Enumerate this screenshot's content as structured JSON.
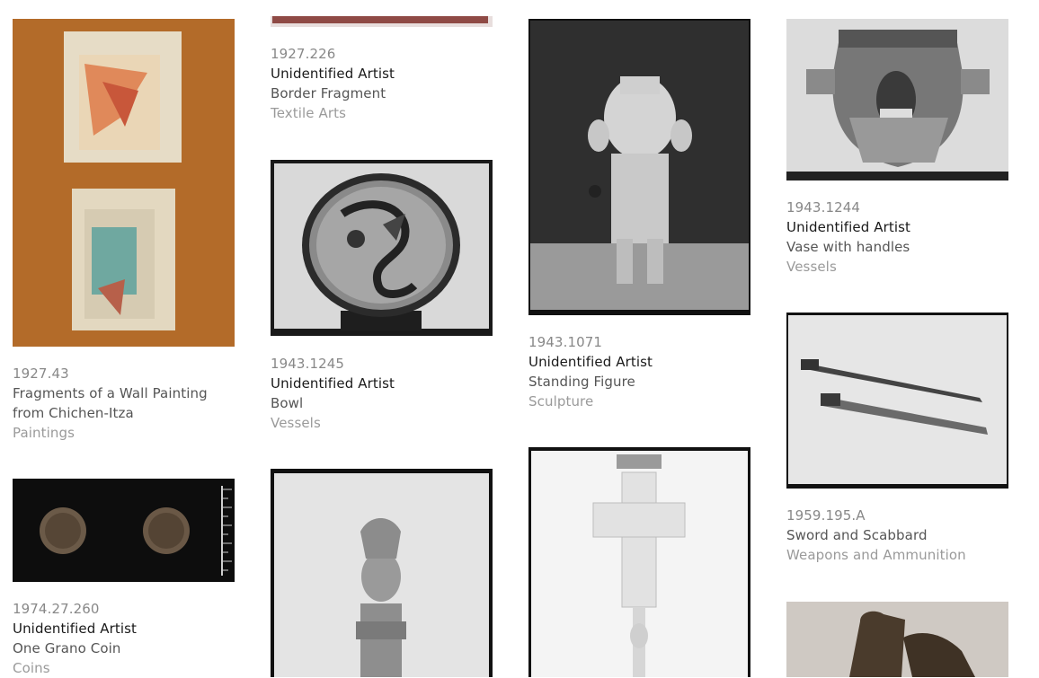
{
  "items": [
    {
      "accession": "1927.43",
      "artist": "",
      "title_line1": "Fragments of a Wall Painting",
      "title_line2": "from Chichen-Itza",
      "classification": "Paintings"
    },
    {
      "accession": "1974.27.260",
      "artist": "Unidentified Artist",
      "title": "One Grano Coin",
      "classification": "Coins"
    },
    {
      "accession": "1927.226",
      "artist": "Unidentified Artist",
      "title": "Border Fragment",
      "classification": "Textile Arts"
    },
    {
      "accession": "1943.1245",
      "artist": "Unidentified Artist",
      "title": "Bowl",
      "classification": "Vessels"
    },
    {
      "accession": "",
      "artist": "",
      "title": "",
      "classification": ""
    },
    {
      "accession": "1943.1071",
      "artist": "Unidentified Artist",
      "title": "Standing Figure",
      "classification": "Sculpture"
    },
    {
      "accession": "",
      "artist": "",
      "title": "",
      "classification": ""
    },
    {
      "accession": "1943.1244",
      "artist": "Unidentified Artist",
      "title": "Vase with handles",
      "classification": "Vessels"
    },
    {
      "accession": "1959.195.A",
      "artist": "",
      "title": "Sword and Scabbard",
      "classification": "Weapons and Ammunition"
    },
    {
      "accession": "",
      "artist": "",
      "title": "",
      "classification": ""
    }
  ],
  "colors": {
    "accession": "#888888",
    "artist": "#1a1a1a",
    "title": "#555555",
    "classification": "#9a9a9a"
  }
}
